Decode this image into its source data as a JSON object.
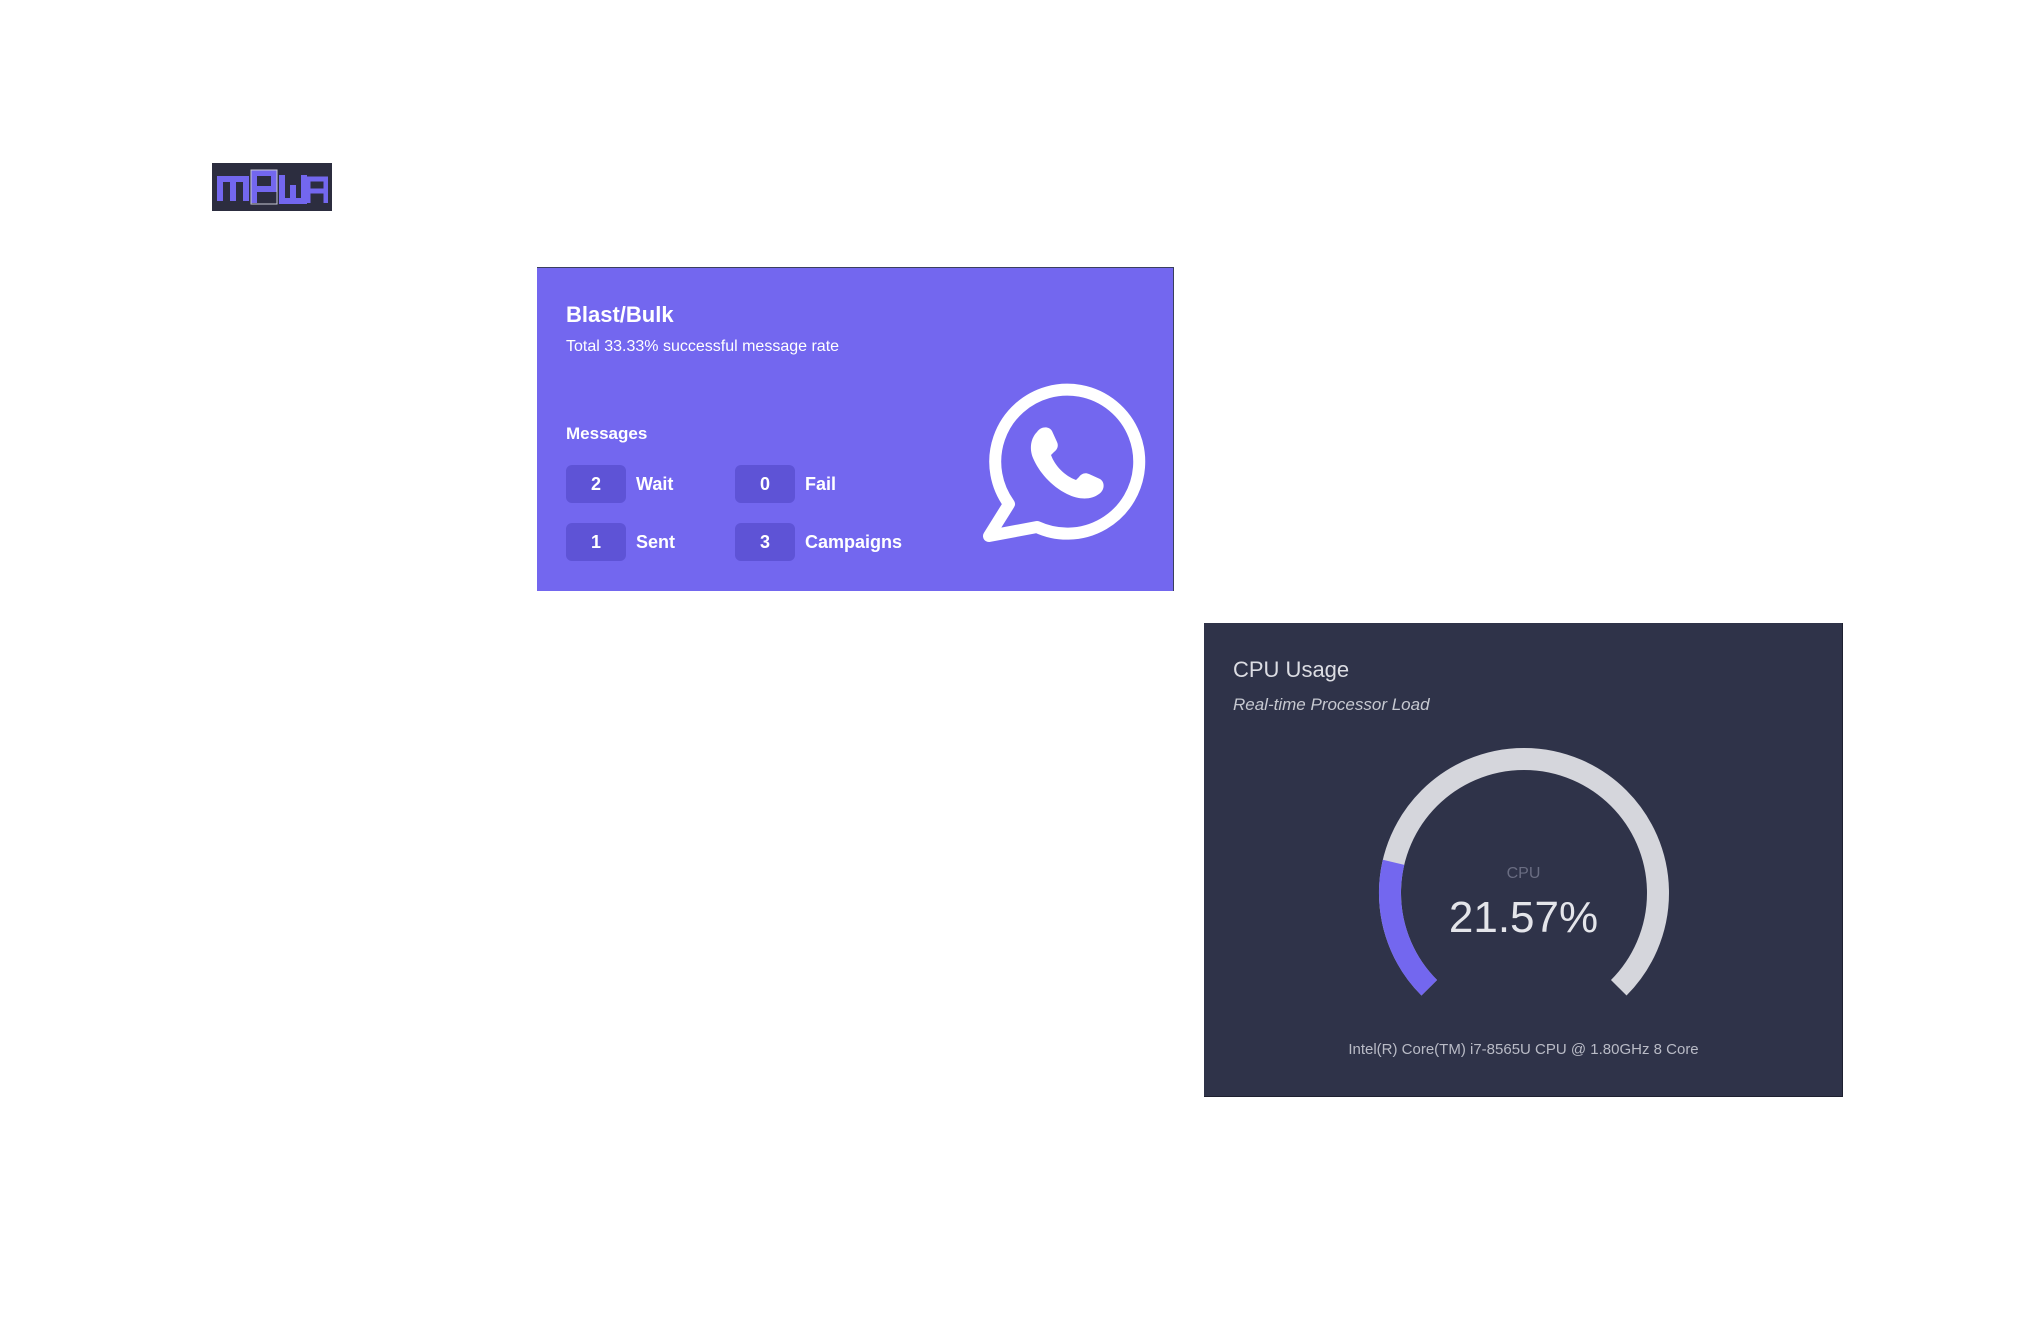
{
  "logo": {
    "text": "mPWA",
    "colors": {
      "background": "#2c2d3f",
      "letters": "#7367ef"
    }
  },
  "blast": {
    "title": "Blast/Bulk",
    "subtitle": "Total 33.33% successful message rate",
    "messages_heading": "Messages",
    "stats": [
      {
        "value": "2",
        "label": "Wait"
      },
      {
        "value": "0",
        "label": "Fail"
      },
      {
        "value": "1",
        "label": "Sent"
      },
      {
        "value": "3",
        "label": "Campaigns"
      }
    ],
    "icon": "whatsapp-icon",
    "colors": {
      "background": "#7367ef",
      "badge": "#5e53d6"
    }
  },
  "cpu": {
    "title": "CPU Usage",
    "subtitle": "Real-time Processor Load",
    "gauge_label": "CPU",
    "gauge_value_text": "21.57%",
    "gauge_percent": 21.57,
    "model": "Intel(R) Core(TM) i7-8565U CPU @ 1.80GHz 8 Core",
    "colors": {
      "background": "#2f3349",
      "track": "#d5d6dc",
      "fill": "#7367ef"
    }
  }
}
